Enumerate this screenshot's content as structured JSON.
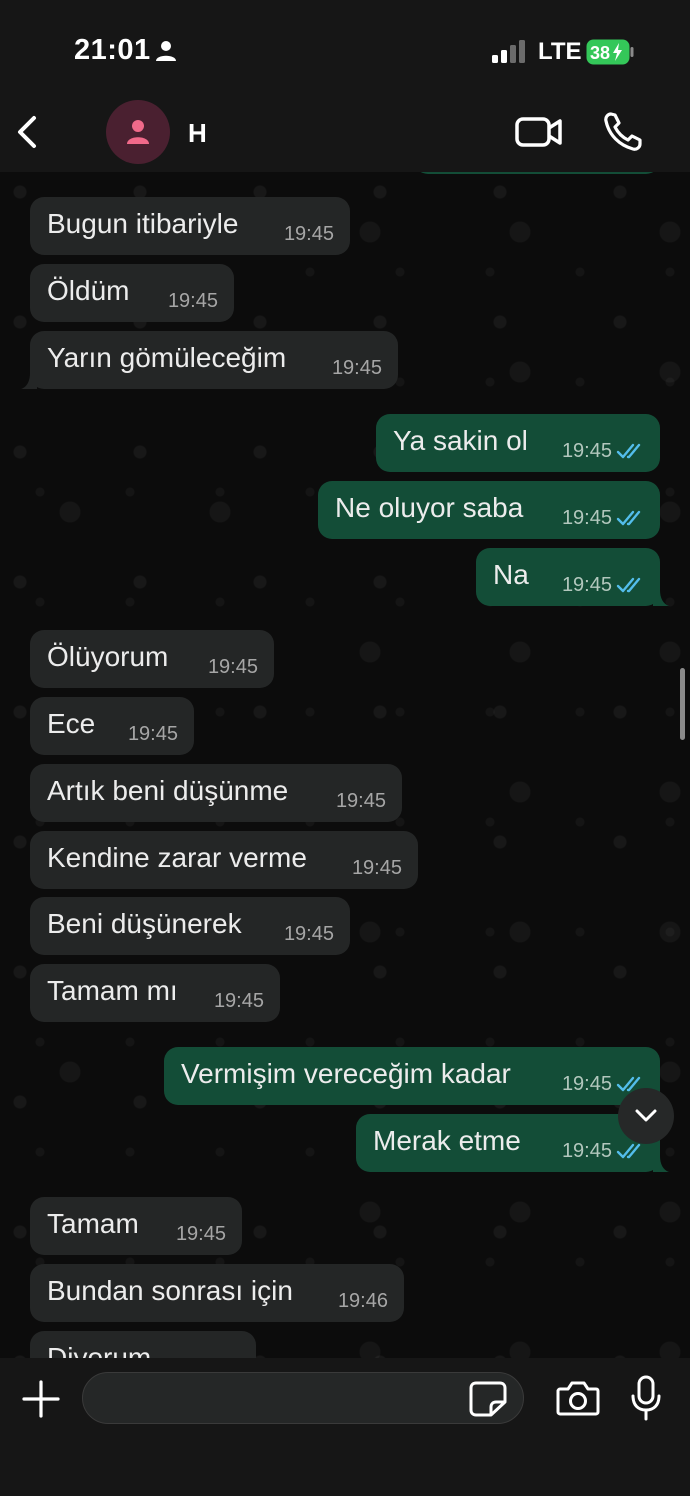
{
  "status_bar": {
    "time": "21:01",
    "network": "LTE",
    "battery": "38",
    "battery_color": "#34c759"
  },
  "header": {
    "contact_name": "H",
    "avatar_bg": "#4a2030",
    "avatar_icon_color": "#f06a8a"
  },
  "colors": {
    "incoming_bubble": "#242626",
    "outgoing_bubble": "#134d37",
    "read_ticks": "#53bdeb"
  },
  "messages": [
    {
      "direction": "in",
      "text": "Bugun itibariyle",
      "time": "19:45"
    },
    {
      "direction": "in",
      "text": "Öldüm",
      "time": "19:45"
    },
    {
      "direction": "in",
      "text": "Yarın gömüleceğim",
      "time": "19:45"
    },
    {
      "direction": "out",
      "text": "Ya sakin ol",
      "time": "19:45"
    },
    {
      "direction": "out",
      "text": "Ne oluyor saba",
      "time": "19:45"
    },
    {
      "direction": "out",
      "text": "Na",
      "time": "19:45"
    },
    {
      "direction": "in",
      "text": "Ölüyorum",
      "time": "19:45"
    },
    {
      "direction": "in",
      "text": "Ece",
      "time": "19:45"
    },
    {
      "direction": "in",
      "text": "Artık beni düşünme",
      "time": "19:45"
    },
    {
      "direction": "in",
      "text": "Kendine zarar verme",
      "time": "19:45"
    },
    {
      "direction": "in",
      "text": "Beni düşünerek",
      "time": "19:45"
    },
    {
      "direction": "in",
      "text": "Tamam mı",
      "time": "19:45"
    },
    {
      "direction": "out",
      "text": "Vermişim vereceğim kadar",
      "time": "19:45"
    },
    {
      "direction": "out",
      "text": "Merak etme",
      "time": "19:45"
    },
    {
      "direction": "in",
      "text": "Tamam",
      "time": "19:45"
    },
    {
      "direction": "in",
      "text": "Bundan sonrası için",
      "time": "19:46"
    },
    {
      "direction": "in",
      "text": "Diyorum",
      "time": ""
    }
  ],
  "composer": {
    "placeholder": ""
  }
}
